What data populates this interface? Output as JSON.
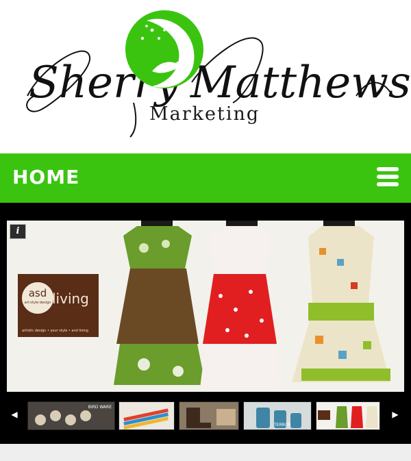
{
  "logo": {
    "name_first": "Sherry",
    "name_last": "Matthews",
    "subtitle": "Marketing",
    "emblem_icon": "moon-woman-stars-icon"
  },
  "nav": {
    "title": "HOME",
    "menu_icon": "hamburger-menu-icon"
  },
  "slider": {
    "info_label": "i",
    "brand_card": {
      "logo_text": "asd",
      "logo_subtext": "art·style·design",
      "word": "living",
      "tagline": "artistic design • your style • and living"
    },
    "thumbnails": [
      {
        "label": "BIRD WARE",
        "kind": "muffin-tins"
      },
      {
        "label": "",
        "kind": "colorful-knives"
      },
      {
        "label": "",
        "kind": "boots-cowboy"
      },
      {
        "label": "TERROR",
        "kind": "blue-canisters"
      },
      {
        "label": "",
        "kind": "aprons"
      }
    ],
    "prev_icon": "left-arrow-icon",
    "next_icon": "right-arrow-icon"
  },
  "colors": {
    "brand_green": "#3ac40f",
    "slider_bg": "#000000",
    "asd_brown": "#5a2d16"
  }
}
